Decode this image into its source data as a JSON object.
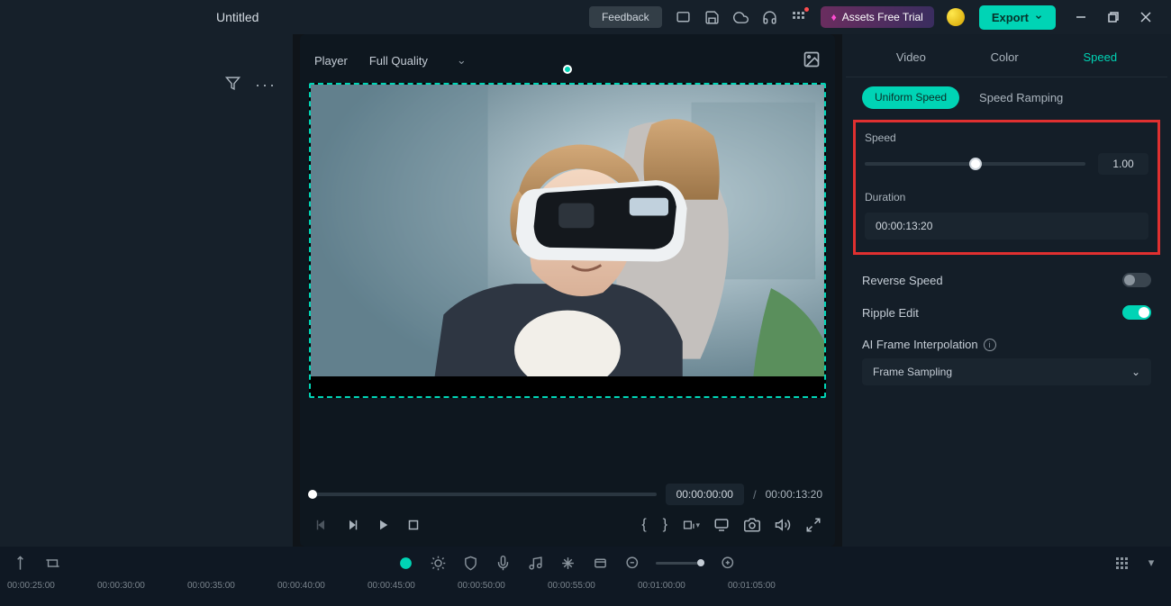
{
  "titlebar": {
    "title": "Untitled",
    "feedback_label": "Feedback",
    "assets_trial_label": "Assets Free Trial",
    "export_label": "Export"
  },
  "player": {
    "label": "Player",
    "quality": "Full Quality",
    "current_time": "00:00:00:00",
    "duration": "00:00:13:20"
  },
  "right_panel": {
    "tabs": {
      "video": "Video",
      "color": "Color",
      "speed": "Speed"
    },
    "subtabs": {
      "uniform": "Uniform Speed",
      "ramping": "Speed Ramping"
    },
    "speed": {
      "label": "Speed",
      "value": "1.00"
    },
    "duration": {
      "label": "Duration",
      "value": "00:00:13:20"
    },
    "reverse_label": "Reverse Speed",
    "ripple_label": "Ripple Edit",
    "ai_frame": {
      "label": "AI Frame Interpolation",
      "value": "Frame Sampling"
    }
  },
  "timeline": {
    "ticks": [
      "00:00:25:00",
      "00:00:30:00",
      "00:00:35:00",
      "00:00:40:00",
      "00:00:45:00",
      "00:00:50:00",
      "00:00:55:00",
      "00:01:00:00",
      "00:01:05:00"
    ]
  }
}
